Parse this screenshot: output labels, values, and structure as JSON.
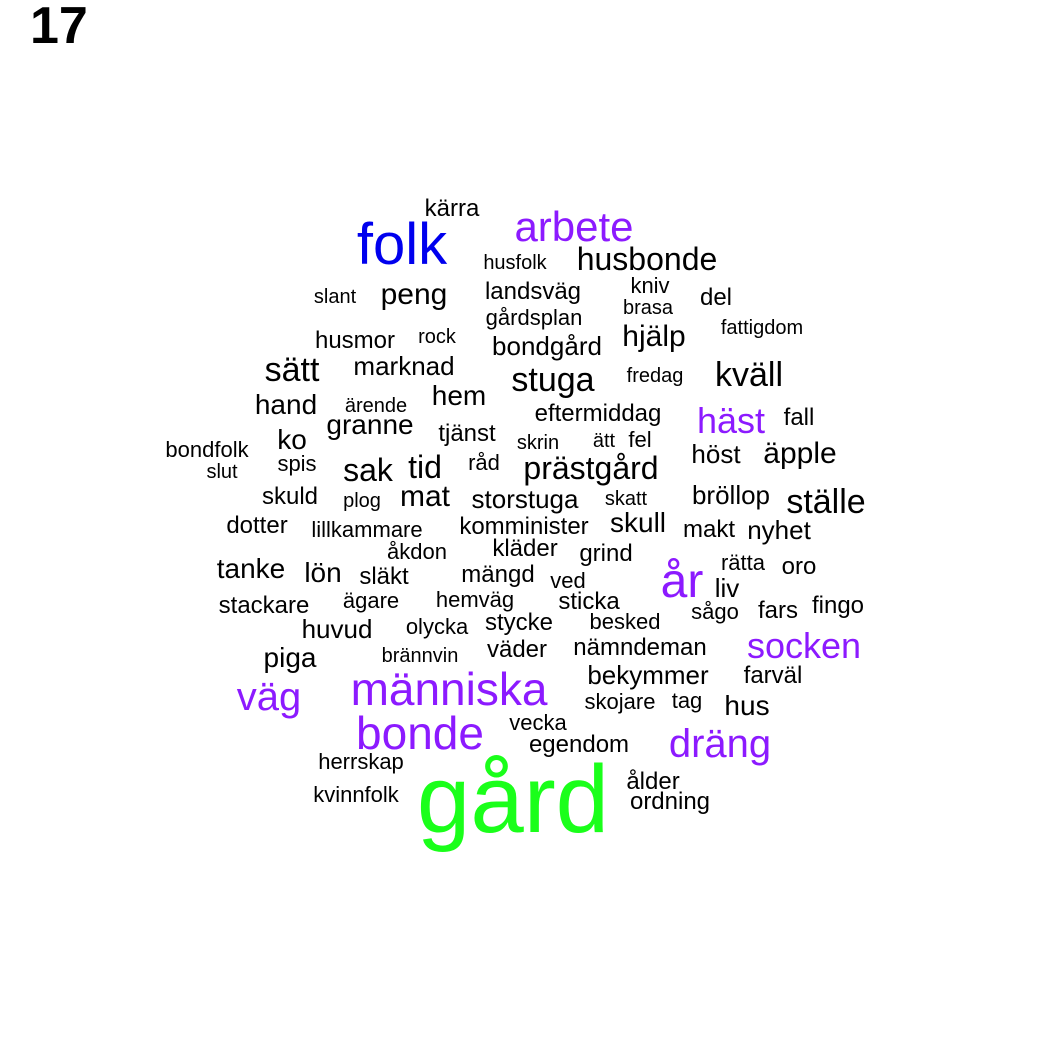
{
  "panel_number": "17",
  "colors": {
    "level1": "#000000",
    "level2": "#8c1aff",
    "level3": "#0000ee",
    "level4": "#1aff1a"
  },
  "words": [
    {
      "text": "gård",
      "level": 4
    },
    {
      "text": "folk",
      "level": 3
    },
    {
      "text": "arbete",
      "level": 2
    },
    {
      "text": "år",
      "level": 2
    },
    {
      "text": "människa",
      "level": 2
    },
    {
      "text": "bonde",
      "level": 2
    },
    {
      "text": "väg",
      "level": 2
    },
    {
      "text": "dräng",
      "level": 2
    },
    {
      "text": "socken",
      "level": 2
    },
    {
      "text": "häst",
      "level": 2
    },
    {
      "text": "kärra",
      "level": 1
    },
    {
      "text": "husfolk",
      "level": 1
    },
    {
      "text": "husbonde",
      "level": 1
    },
    {
      "text": "slant",
      "level": 1
    },
    {
      "text": "peng",
      "level": 1
    },
    {
      "text": "landsväg",
      "level": 1
    },
    {
      "text": "kniv",
      "level": 1
    },
    {
      "text": "del",
      "level": 1
    },
    {
      "text": "brasa",
      "level": 1
    },
    {
      "text": "gårdsplan",
      "level": 1
    },
    {
      "text": "fattigdom",
      "level": 1
    },
    {
      "text": "husmor",
      "level": 1
    },
    {
      "text": "rock",
      "level": 1
    },
    {
      "text": "hjälp",
      "level": 1
    },
    {
      "text": "bondgård",
      "level": 1
    },
    {
      "text": "sätt",
      "level": 1
    },
    {
      "text": "marknad",
      "level": 1
    },
    {
      "text": "stuga",
      "level": 1
    },
    {
      "text": "fredag",
      "level": 1
    },
    {
      "text": "kväll",
      "level": 1
    },
    {
      "text": "hand",
      "level": 1
    },
    {
      "text": "ärende",
      "level": 1
    },
    {
      "text": "hem",
      "level": 1
    },
    {
      "text": "eftermiddag",
      "level": 1
    },
    {
      "text": "fall",
      "level": 1
    },
    {
      "text": "granne",
      "level": 1
    },
    {
      "text": "tjänst",
      "level": 1
    },
    {
      "text": "ko",
      "level": 1
    },
    {
      "text": "skrin",
      "level": 1
    },
    {
      "text": "ätt",
      "level": 1
    },
    {
      "text": "fel",
      "level": 1
    },
    {
      "text": "bondfolk",
      "level": 1
    },
    {
      "text": "höst",
      "level": 1
    },
    {
      "text": "äpple",
      "level": 1
    },
    {
      "text": "spis",
      "level": 1
    },
    {
      "text": "sak",
      "level": 1
    },
    {
      "text": "tid",
      "level": 1
    },
    {
      "text": "råd",
      "level": 1
    },
    {
      "text": "prästgård",
      "level": 1
    },
    {
      "text": "slut",
      "level": 1
    },
    {
      "text": "skuld",
      "level": 1
    },
    {
      "text": "plog",
      "level": 1
    },
    {
      "text": "mat",
      "level": 1
    },
    {
      "text": "storstuga",
      "level": 1
    },
    {
      "text": "skatt",
      "level": 1
    },
    {
      "text": "bröllop",
      "level": 1
    },
    {
      "text": "ställe",
      "level": 1
    },
    {
      "text": "dotter",
      "level": 1
    },
    {
      "text": "lillkammare",
      "level": 1
    },
    {
      "text": "komminister",
      "level": 1
    },
    {
      "text": "skull",
      "level": 1
    },
    {
      "text": "makt",
      "level": 1
    },
    {
      "text": "nyhet",
      "level": 1
    },
    {
      "text": "åkdon",
      "level": 1
    },
    {
      "text": "kläder",
      "level": 1
    },
    {
      "text": "grind",
      "level": 1
    },
    {
      "text": "rätta",
      "level": 1
    },
    {
      "text": "tanke",
      "level": 1
    },
    {
      "text": "lön",
      "level": 1
    },
    {
      "text": "släkt",
      "level": 1
    },
    {
      "text": "mängd",
      "level": 1
    },
    {
      "text": "ved",
      "level": 1
    },
    {
      "text": "liv",
      "level": 1
    },
    {
      "text": "oro",
      "level": 1
    },
    {
      "text": "stackare",
      "level": 1
    },
    {
      "text": "ägare",
      "level": 1
    },
    {
      "text": "hemväg",
      "level": 1
    },
    {
      "text": "sticka",
      "level": 1
    },
    {
      "text": "sågo",
      "level": 1
    },
    {
      "text": "fars",
      "level": 1
    },
    {
      "text": "fingo",
      "level": 1
    },
    {
      "text": "huvud",
      "level": 1
    },
    {
      "text": "olycka",
      "level": 1
    },
    {
      "text": "stycke",
      "level": 1
    },
    {
      "text": "besked",
      "level": 1
    },
    {
      "text": "piga",
      "level": 1
    },
    {
      "text": "brännvin",
      "level": 1
    },
    {
      "text": "väder",
      "level": 1
    },
    {
      "text": "nämndeman",
      "level": 1
    },
    {
      "text": "bekymmer",
      "level": 1
    },
    {
      "text": "farväl",
      "level": 1
    },
    {
      "text": "skojare",
      "level": 1
    },
    {
      "text": "tag",
      "level": 1
    },
    {
      "text": "hus",
      "level": 1
    },
    {
      "text": "vecka",
      "level": 1
    },
    {
      "text": "egendom",
      "level": 1
    },
    {
      "text": "herrskap",
      "level": 1
    },
    {
      "text": "ålder",
      "level": 1
    },
    {
      "text": "kvinnfolk",
      "level": 1
    },
    {
      "text": "ordning",
      "level": 1
    }
  ]
}
